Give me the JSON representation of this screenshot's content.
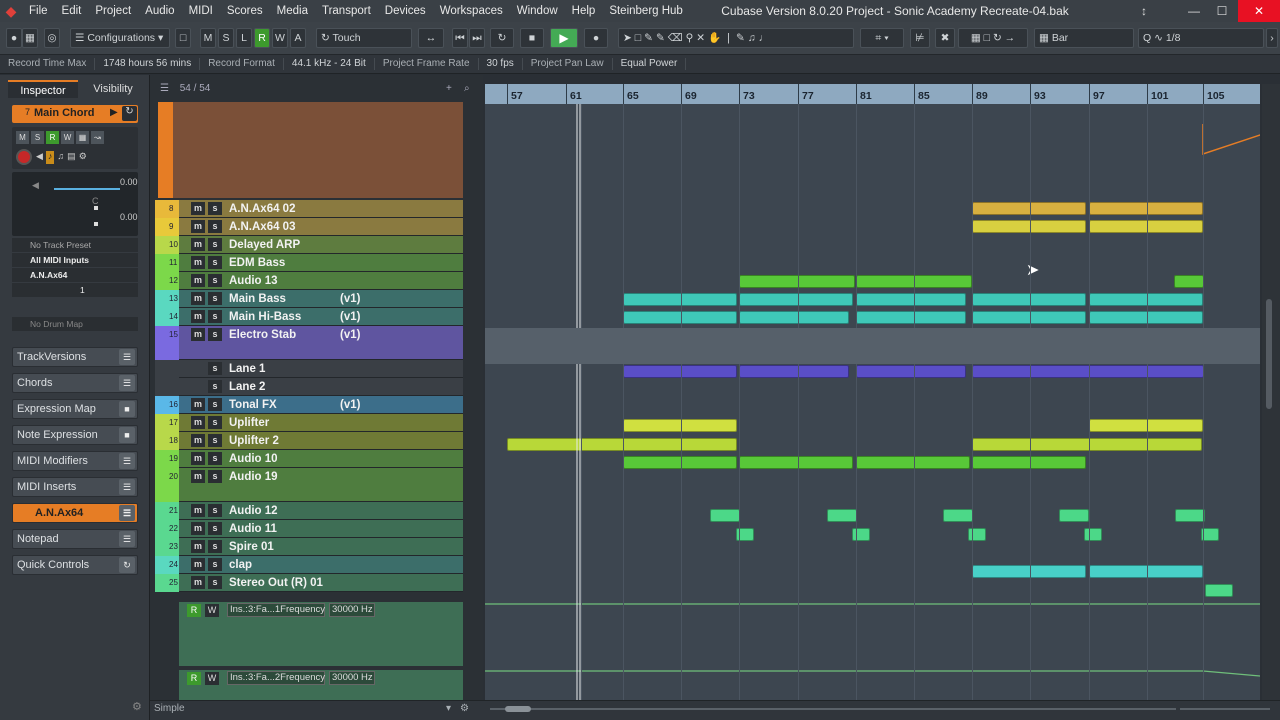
{
  "window": {
    "title": "Cubase Version 8.0.20 Project - Sonic Academy Recreate-04.bak",
    "menus": [
      "File",
      "Edit",
      "Project",
      "Audio",
      "MIDI",
      "Scores",
      "Media",
      "Transport",
      "Devices",
      "Workspaces",
      "Window",
      "Help",
      "Steinberg Hub"
    ]
  },
  "toolbar": {
    "configurations": "Configurations",
    "mode_buttons": [
      "M",
      "S",
      "L",
      "R",
      "W",
      "A"
    ],
    "automation_mode": "Touch",
    "grid_type": "Bar",
    "quantize": "1/8"
  },
  "infobar": [
    {
      "label": "Record Time Max",
      "value": "1748 hours 56 mins"
    },
    {
      "label": "Record Format",
      "value": "44.1 kHz - 24 Bit"
    },
    {
      "label": "Project Frame Rate",
      "value": "30 fps"
    },
    {
      "label": "Project Pan Law",
      "value": "Equal Power"
    }
  ],
  "inspector": {
    "tabs": [
      "Inspector",
      "Visibility"
    ],
    "track_number": "7",
    "track_name": "Main Chord",
    "volume": "0.00",
    "pan_value": "C",
    "delay": "0.00",
    "track_preset": "No Track Preset",
    "midi_input": "All MIDI Inputs",
    "midi_output": "A.N.Ax64",
    "channel": "1",
    "drum_map": "No Drum Map",
    "sections": [
      "TrackVersions",
      "Chords",
      "Expression Map",
      "Note Expression",
      "MIDI Modifiers",
      "MIDI Inserts",
      "A.N.Ax64",
      "Notepad",
      "Quick Controls"
    ]
  },
  "tracklist": {
    "counter": "54 / 54",
    "footer": "Simple",
    "tracks": [
      {
        "num": "8",
        "name": "A.N.Ax64 02",
        "version": ""
      },
      {
        "num": "9",
        "name": "A.N.Ax64 03",
        "version": ""
      },
      {
        "num": "10",
        "name": "Delayed ARP",
        "version": ""
      },
      {
        "num": "11",
        "name": "EDM Bass",
        "version": ""
      },
      {
        "num": "12",
        "name": "Audio 13",
        "version": ""
      },
      {
        "num": "13",
        "name": "Main Bass",
        "version": "(v1)"
      },
      {
        "num": "14",
        "name": "Main Hi-Bass",
        "version": "(v1)"
      },
      {
        "num": "15",
        "name": "Electro Stab",
        "version": "(v1)"
      },
      {
        "num": "",
        "name": "Lane 1",
        "version": ""
      },
      {
        "num": "",
        "name": "Lane 2",
        "version": ""
      },
      {
        "num": "16",
        "name": "Tonal FX",
        "version": "(v1)"
      },
      {
        "num": "17",
        "name": "Uplifter",
        "version": ""
      },
      {
        "num": "18",
        "name": "Uplifter 2",
        "version": ""
      },
      {
        "num": "19",
        "name": "Audio 10",
        "version": ""
      },
      {
        "num": "20",
        "name": "Audio 19",
        "version": ""
      },
      {
        "num": "21",
        "name": "Audio 12",
        "version": ""
      },
      {
        "num": "22",
        "name": "Audio 11",
        "version": ""
      },
      {
        "num": "23",
        "name": "Spire 01",
        "version": ""
      },
      {
        "num": "24",
        "name": "clap",
        "version": ""
      },
      {
        "num": "25",
        "name": "Stereo Out (R) 01",
        "version": ""
      }
    ],
    "automation": [
      {
        "param": "Ins.:3:Fa...1Frequency",
        "value": "30000 Hz"
      },
      {
        "param": "Ins.:3:Fa...2Frequency",
        "value": "30000 Hz"
      }
    ]
  },
  "ruler": {
    "bars": [
      "57",
      "61",
      "65",
      "69",
      "73",
      "77",
      "81",
      "85",
      "89",
      "93",
      "97",
      "101",
      "105"
    ]
  },
  "events": {
    "electro_stab_label": "Electro Stab"
  },
  "colors": {
    "accent": "#e67d25",
    "ruler": "#8ea9c0",
    "arrange_bg": "#3d4650"
  }
}
